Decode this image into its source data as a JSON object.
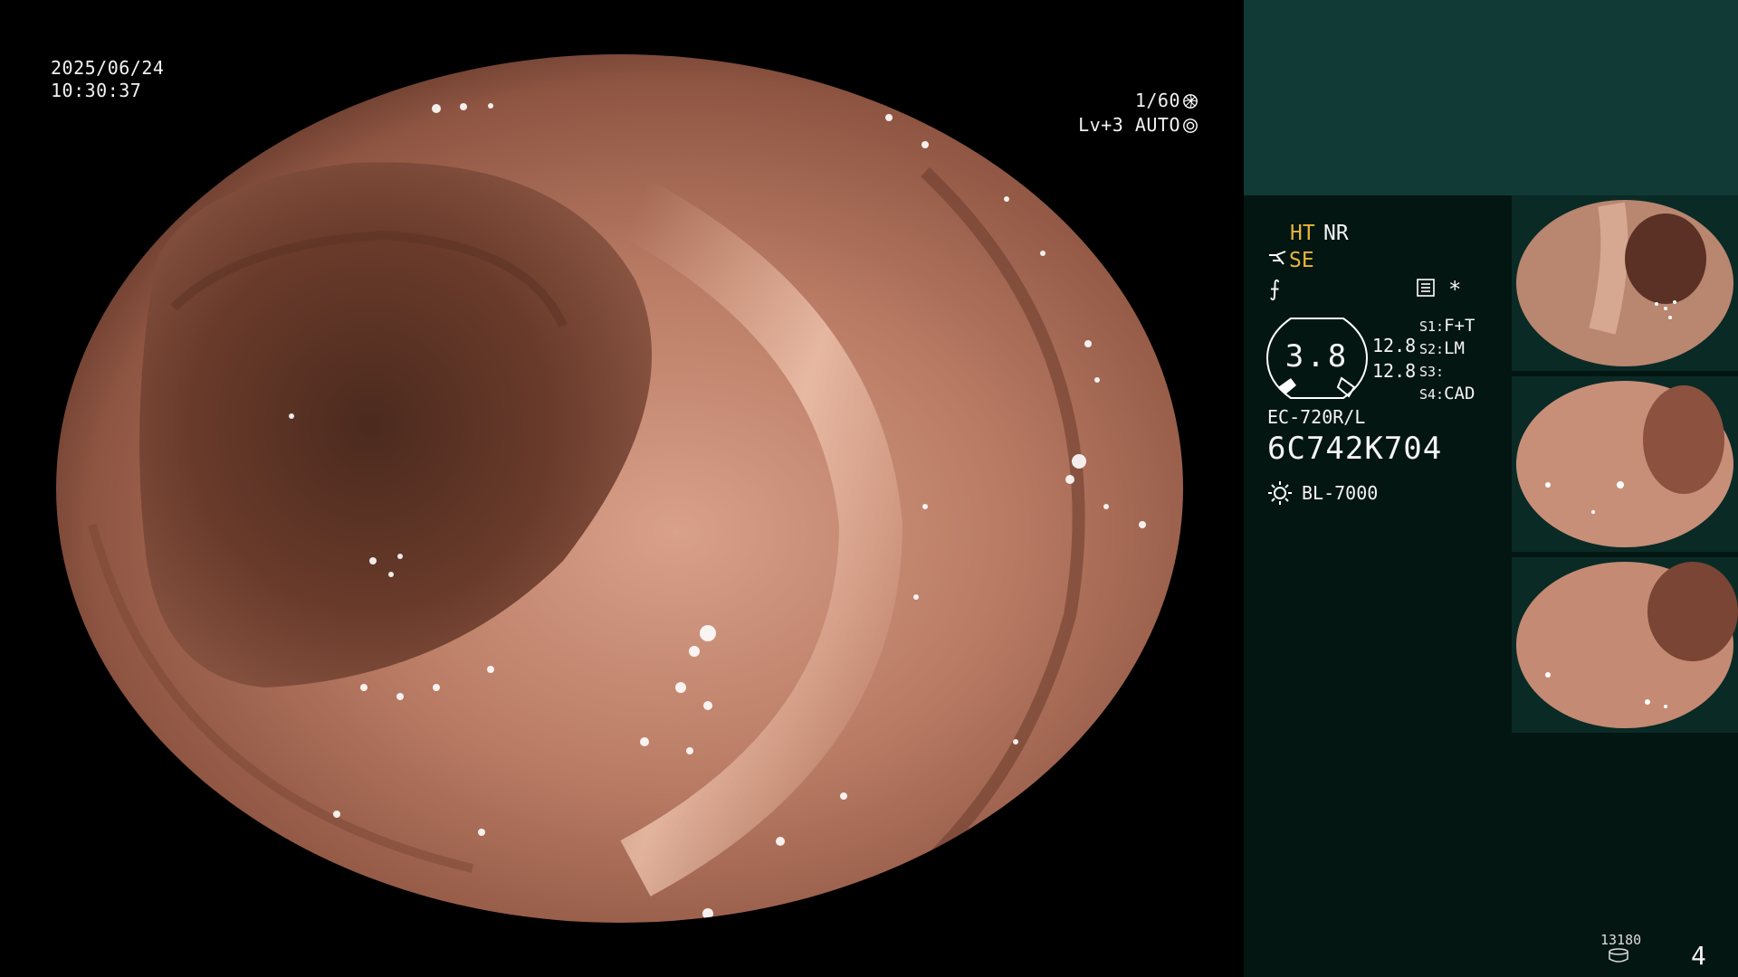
{
  "osd": {
    "date": "2025/06/24",
    "time": "10:30:37",
    "shutter": "1/60",
    "shutter_icon": "shutter-icon",
    "level": "Lv+3 AUTO",
    "auto_icon": "iris-icon"
  },
  "modes": {
    "ht": "HT",
    "nr": "NR",
    "se": "SE",
    "enhance_icon": "structure-enhance-icon",
    "f_glyph": "⨍",
    "asterisk": "*",
    "menu_icon": "menu-icon"
  },
  "zoom": {
    "value": "3.8",
    "value_a": "12.8",
    "value_b": "12.8"
  },
  "switches": [
    {
      "key": "S1:",
      "value": "F+T"
    },
    {
      "key": "S2:",
      "value": "LM"
    },
    {
      "key": "S3:",
      "value": ""
    },
    {
      "key": "S4:",
      "value": "CAD"
    }
  ],
  "scope": {
    "model": "EC-720R/L",
    "serial": "6C742K704",
    "light_source": "BL-7000",
    "light_icon": "lamp-icon"
  },
  "footer": {
    "counter": "13180",
    "counter_icon": "storage-icon",
    "page": "4"
  },
  "colors": {
    "panel_top": "#113a36",
    "panel_main": "#041612",
    "accent_yellow": "#e8b43a",
    "tissue": "#b57a64"
  }
}
